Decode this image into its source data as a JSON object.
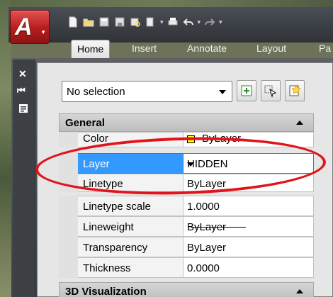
{
  "app": {
    "logo_letter": "A"
  },
  "ribbon": {
    "tabs": [
      {
        "label": "Home",
        "active": true
      },
      {
        "label": "Insert"
      },
      {
        "label": "Annotate"
      },
      {
        "label": "Layout"
      },
      {
        "label": "Pa"
      }
    ]
  },
  "quick_access": {
    "icons": [
      "new-icon",
      "open-icon",
      "save-icon",
      "save-as-icon",
      "print-preview-icon",
      "plot-icon",
      "undo-icon",
      "redo-icon"
    ]
  },
  "palette": {
    "side_icons": [
      "close-icon",
      "auto-hide-icon",
      "properties-icon"
    ],
    "selection_value": "No selection",
    "toolbar_buttons": [
      "toggle-pickadd-icon",
      "select-objects-icon",
      "quick-select-icon"
    ]
  },
  "sections": {
    "general": "General",
    "visualization": "3D Visualization"
  },
  "properties": [
    {
      "name": "Color",
      "value": "ByLayer",
      "swatch": "#ffff00"
    },
    {
      "name": "Layer",
      "value": "HIDDEN",
      "selected": true
    },
    {
      "name": "Linetype",
      "value": "ByLayer"
    },
    {
      "name": "Linetype scale",
      "value": "1.0000"
    },
    {
      "name": "Lineweight",
      "value": "ByLayer"
    },
    {
      "name": "Transparency",
      "value": "ByLayer"
    },
    {
      "name": "Thickness",
      "value": "0.0000"
    }
  ],
  "colors": {
    "highlight": "#3399ff",
    "annotation": "#e0141b",
    "app_button": "#c0262b"
  }
}
